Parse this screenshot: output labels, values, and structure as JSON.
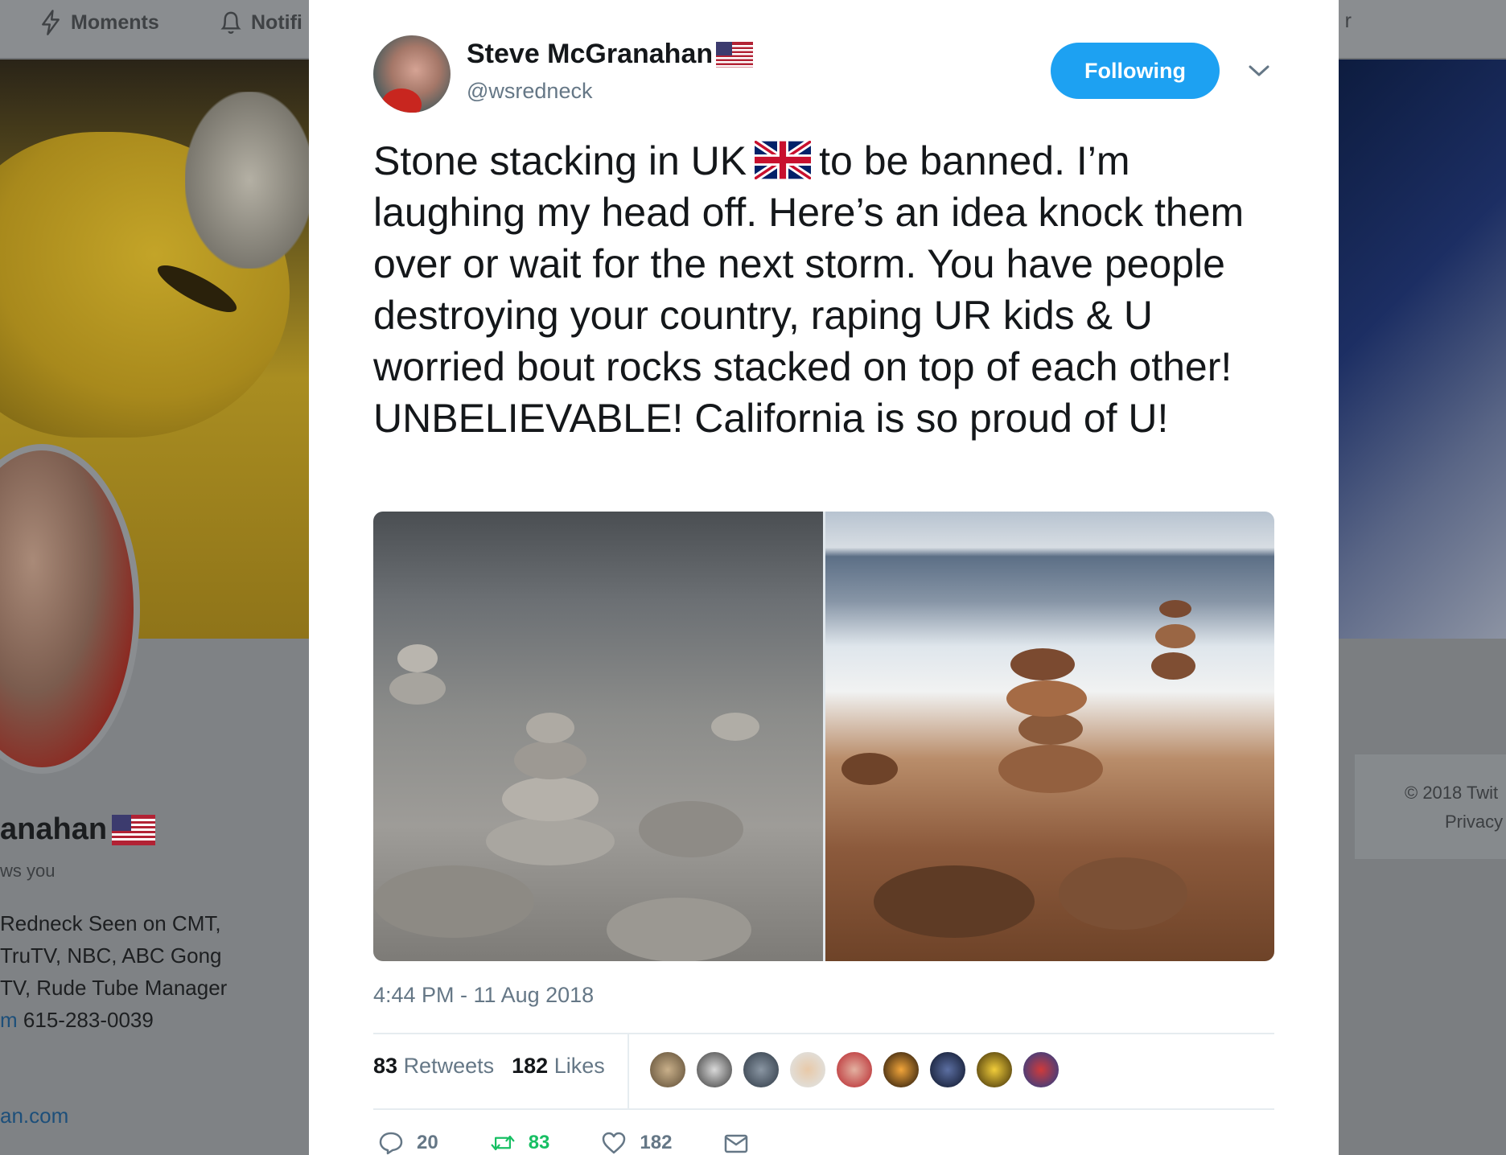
{
  "nav": {
    "moments_label": "Moments",
    "notifications_label": "Notifi",
    "right_fragment": "r"
  },
  "background_profile": {
    "name_fragment": "anahan",
    "follows_you_fragment": "ws you",
    "bio_lines": [
      "Redneck Seen on CMT,",
      "TruTV, NBC, ABC Gong",
      "TV, Rude Tube Manager"
    ],
    "bio_contact_prefix": "m",
    "bio_phone": "615-283-0039",
    "link_fragment": "an.com",
    "footer_copyright": "© 2018 Twit",
    "footer_privacy": "Privacy"
  },
  "tweet": {
    "author_name": "Steve McGranahan",
    "author_handle": "@wsredneck",
    "follow_button_label": "Following",
    "text_part1": "Stone stacking in UK",
    "text_part2": "to be banned. I’m laughing my head off. Here’s an idea knock them over or wait for the next storm. You have people destroying your country, raping UR kids & U worried bout rocks stacked on top of each other! UNBELIEVABLE! California is so proud of U!",
    "timestamp": "4:44 PM - 11 Aug 2018",
    "retweets_count": "83",
    "retweets_label": "Retweets",
    "likes_count": "182",
    "likes_label": "Likes",
    "actions": {
      "reply_count": "20",
      "retweet_count": "83",
      "like_count": "182"
    }
  },
  "icons": [
    "lightning-icon",
    "bell-icon",
    "us-flag-icon",
    "uk-flag-icon",
    "chevron-down-icon",
    "reply-icon",
    "retweet-icon",
    "heart-icon",
    "envelope-icon"
  ],
  "colors": {
    "accent": "#1da1f2",
    "text_primary": "#14171a",
    "text_secondary": "#657786",
    "retweet_green": "#17bf63"
  }
}
